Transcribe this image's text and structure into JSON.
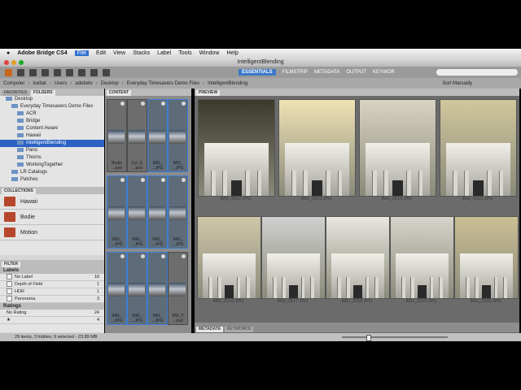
{
  "menubar": {
    "app": "Adobe Bridge CS4",
    "items": [
      "File",
      "Edit",
      "View",
      "Stacks",
      "Label",
      "Tools",
      "Window",
      "Help"
    ]
  },
  "window_title": "IntelligentBlending",
  "workspace_tabs": [
    "ESSENTIALS",
    "FILMSTRIP",
    "METADATA",
    "OUTPUT",
    "KEYWOR"
  ],
  "path_bar": {
    "crumbs": [
      "Computer",
      "Icebat",
      "Users",
      "adobetv",
      "Desktop",
      "Everyday Timesavers Demo Files",
      "IntelligentBlending"
    ],
    "sort_label": "Sort Manually"
  },
  "left_tabs": [
    "FAVORITES",
    "FOLDERS"
  ],
  "folders": [
    {
      "label": "Desktop",
      "indent": 1
    },
    {
      "label": "Everyday Timesavers Demo Files",
      "indent": 2
    },
    {
      "label": "ACR",
      "indent": 3
    },
    {
      "label": "Bridge",
      "indent": 3
    },
    {
      "label": "Content Aware",
      "indent": 3
    },
    {
      "label": "Hawaii",
      "indent": 3
    },
    {
      "label": "IntelligentBlending",
      "indent": 3,
      "selected": true
    },
    {
      "label": "Pano",
      "indent": 3
    },
    {
      "label": "Thorns",
      "indent": 3
    },
    {
      "label": "WorkingTogether",
      "indent": 3
    },
    {
      "label": "LR Catalogs",
      "indent": 2
    },
    {
      "label": "Patches",
      "indent": 2
    }
  ],
  "collections_title": "COLLECTIONS",
  "collections": [
    "Hawaii",
    "Bodie",
    "Motion"
  ],
  "filter": {
    "title": "FILTER",
    "labels_head": "Labels",
    "labels": [
      {
        "name": "No Label",
        "count": "18"
      },
      {
        "name": "Depth of Field",
        "count": "1"
      },
      {
        "name": "HDR",
        "count": "1"
      },
      {
        "name": "Panorama",
        "count": "3"
      }
    ],
    "ratings_head": "Ratings",
    "ratings": [
      {
        "name": "No Rating",
        "count": "24"
      },
      {
        "name": "★",
        "count": "4"
      }
    ]
  },
  "content_tab": "CONTENT",
  "content_thumbs": [
    {
      "caption": "Bodie\n...psd",
      "selected": false
    },
    {
      "caption": "Cyl_G\n...psd",
      "selected": false
    },
    {
      "caption": "IMG_\n...JPG",
      "selected": true
    },
    {
      "caption": "IMG_\n...JPG",
      "selected": true
    },
    {
      "caption": "IMG_\n...JPG",
      "selected": true
    },
    {
      "caption": "IMG_\n...JPG",
      "selected": true
    },
    {
      "caption": "IMG_\n...JPG",
      "selected": true
    },
    {
      "caption": "IMG_\n...JPG",
      "selected": true
    },
    {
      "caption": "IMG_\n...JPG",
      "selected": true
    },
    {
      "caption": "IMG_\n...JPG",
      "selected": true
    },
    {
      "caption": "IMG_\n...JPG",
      "selected": true
    },
    {
      "caption": "RW_P\n...psd",
      "selected": false
    }
  ],
  "preview_tab": "PREVIEW",
  "preview_images": [
    {
      "label": "IMG_2512.JPG"
    },
    {
      "label": "IMG_2513.JPG"
    },
    {
      "label": "IMG_2514.JPG"
    },
    {
      "label": "IMG_2515.JPG"
    },
    {
      "label": "IMG_2516.JPG"
    },
    {
      "label": "IMG_2517.JPG"
    },
    {
      "label": "IMG_2518.JPG"
    },
    {
      "label": "IMG_2519.JPG"
    },
    {
      "label": "IMG_2520.JPG"
    }
  ],
  "bottom_tabs": [
    "METADATA",
    "KEYWORDS"
  ],
  "status": "29 items, 3 hidden, 9 selected - 23.89 MB"
}
